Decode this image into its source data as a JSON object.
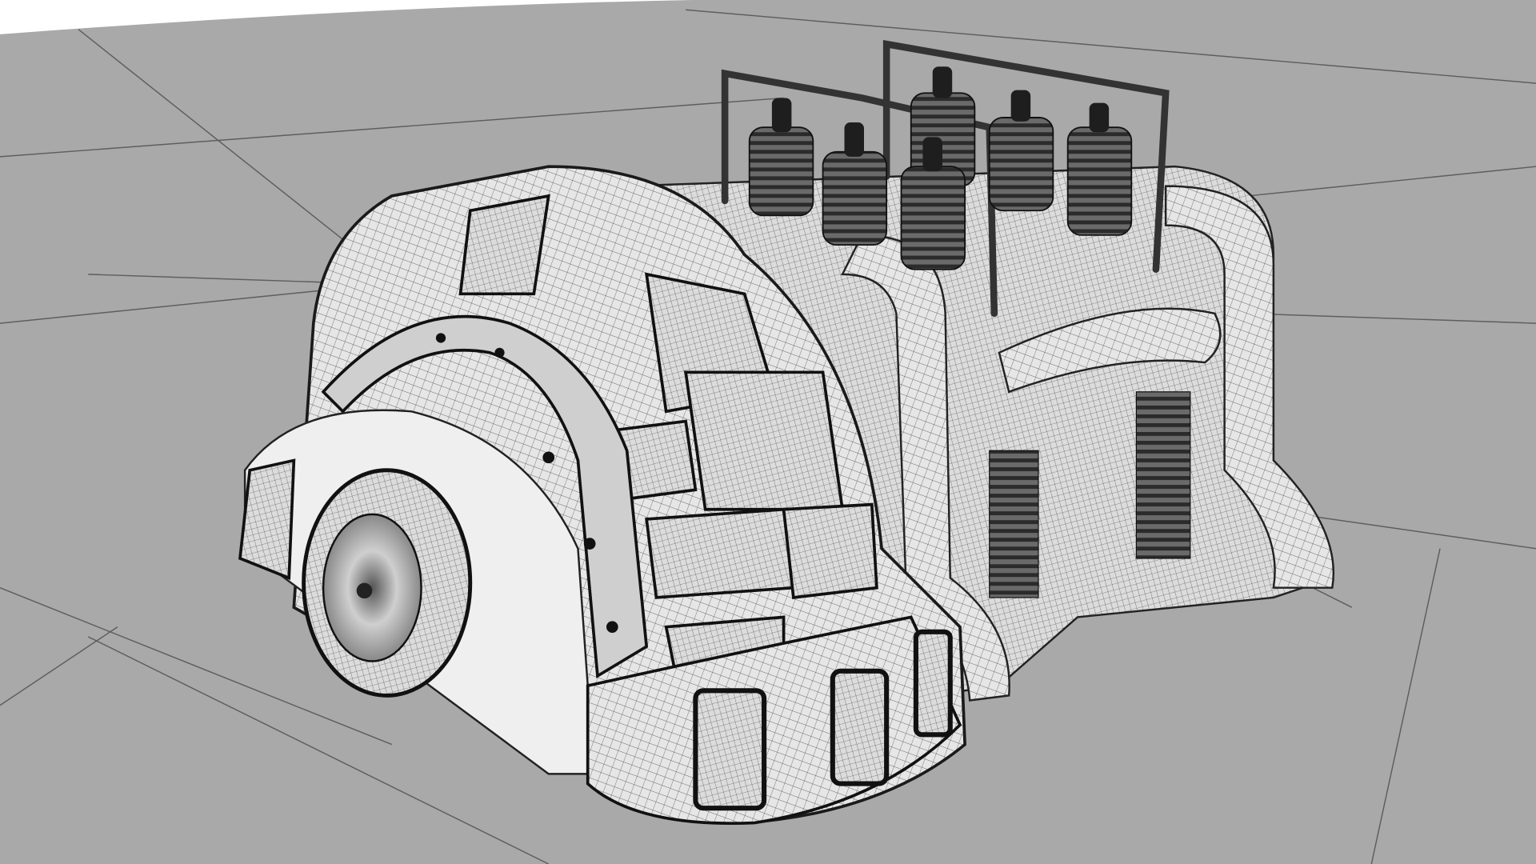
{
  "colors": {
    "sky": "#ffffff",
    "floor": "#a9a9a9",
    "grid_line": "#5a5a5a",
    "model_fill": "#e4e4e4",
    "model_shade": "#c8c8c8",
    "wire": "#2a2a2a",
    "dark": "#1e1e1e"
  }
}
